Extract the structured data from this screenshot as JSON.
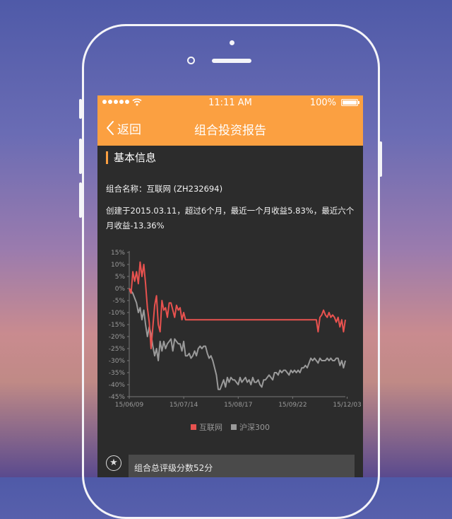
{
  "status_bar": {
    "time": "11:11 AM",
    "battery": "100%"
  },
  "nav": {
    "back_label": "返回",
    "title": "组合投资报告"
  },
  "section": {
    "title": "基本信息"
  },
  "info": {
    "portfolio_name": "组合名称：互联网 (ZH232694)",
    "summary": "创建于2015.03.11，超过6个月，最近一个月收益5.83%，最近六个月收益-13.36%"
  },
  "chart_data": {
    "type": "line",
    "title": "",
    "xlabel": "",
    "ylabel": "",
    "ylim": [
      -45,
      15
    ],
    "y_ticks": [
      "15%",
      "10%",
      "5%",
      "0%",
      "-5%",
      "-10%",
      "-15%",
      "-20%",
      "-25%",
      "-30%",
      "-35%",
      "-40%",
      "-45%"
    ],
    "x_ticks": [
      "15/06/09",
      "15/07/14",
      "15/08/17",
      "15/09/22",
      "15/12/03"
    ],
    "x_tick_index": [
      0,
      30,
      60,
      90,
      120
    ],
    "series": [
      {
        "name": "互联网",
        "color": "#e8524f",
        "values": [
          0,
          -2,
          7,
          3,
          7,
          2,
          11,
          5,
          10,
          2,
          -8,
          -14,
          -25,
          -16,
          -7,
          -3,
          -15,
          -18,
          -5,
          -9,
          -8,
          -12,
          -6,
          -6,
          -9,
          -12,
          -7,
          -9,
          -8,
          -13,
          -10,
          -13,
          -13,
          -13,
          -13,
          -13,
          -13,
          -13,
          -13,
          -13,
          -13,
          -13,
          -13,
          -13,
          -13,
          -13,
          -13,
          -13,
          -13,
          -13,
          -13,
          -13,
          -13,
          -13,
          -13,
          -13,
          -13,
          -13,
          -13,
          -13,
          -13,
          -13,
          -13,
          -13,
          -13,
          -13,
          -13,
          -13,
          -13,
          -13,
          -13,
          -13,
          -13,
          -13,
          -13,
          -13,
          -13,
          -13,
          -13,
          -13,
          -13,
          -13,
          -13,
          -13,
          -13,
          -13,
          -13,
          -13,
          -13,
          -13,
          -13,
          -13,
          -13,
          -13,
          -13,
          -13,
          -13,
          -13,
          -13,
          -13,
          -13,
          -13,
          -13,
          -13,
          -18,
          -12,
          -11,
          -9,
          -11,
          -12,
          -10,
          -12,
          -11,
          -12,
          -14,
          -12,
          -16,
          -13,
          -18,
          -13
        ]
      },
      {
        "name": "沪深300",
        "color": "#9a9a9a",
        "values": [
          0,
          -1,
          -2,
          -4,
          -6,
          -10,
          -8,
          -13,
          -9,
          -15,
          -20,
          -16,
          -19,
          -24,
          -28,
          -25,
          -30,
          -22,
          -26,
          -22,
          -25,
          -23,
          -22,
          -21,
          -26,
          -21,
          -22,
          -23,
          -23,
          -26,
          -22,
          -28,
          -28,
          -27,
          -29,
          -28,
          -26,
          -28,
          -25,
          -24,
          -25,
          -24,
          -24,
          -27,
          -29,
          -28,
          -30,
          -33,
          -36,
          -42,
          -42,
          -40,
          -38,
          -41,
          -37,
          -39,
          -37,
          -38,
          -38,
          -39,
          -40,
          -37,
          -39,
          -38,
          -37,
          -39,
          -38,
          -40,
          -37,
          -39,
          -39,
          -38,
          -40,
          -41,
          -38,
          -38,
          -37,
          -36,
          -37,
          -38,
          -35,
          -35,
          -36,
          -34,
          -35,
          -34,
          -34,
          -35,
          -36,
          -34,
          -35,
          -34,
          -35,
          -34,
          -35,
          -33,
          -33,
          -32,
          -33,
          -31,
          -29,
          -30,
          -29,
          -30,
          -31,
          -29,
          -30,
          -30,
          -30,
          -29,
          -30,
          -29,
          -30,
          -30,
          -29,
          -29,
          -32,
          -30,
          -33,
          -30
        ]
      }
    ],
    "legend_position": "bottom"
  },
  "rating": {
    "text": "组合总评级分数52分",
    "icon": "star-icon"
  }
}
